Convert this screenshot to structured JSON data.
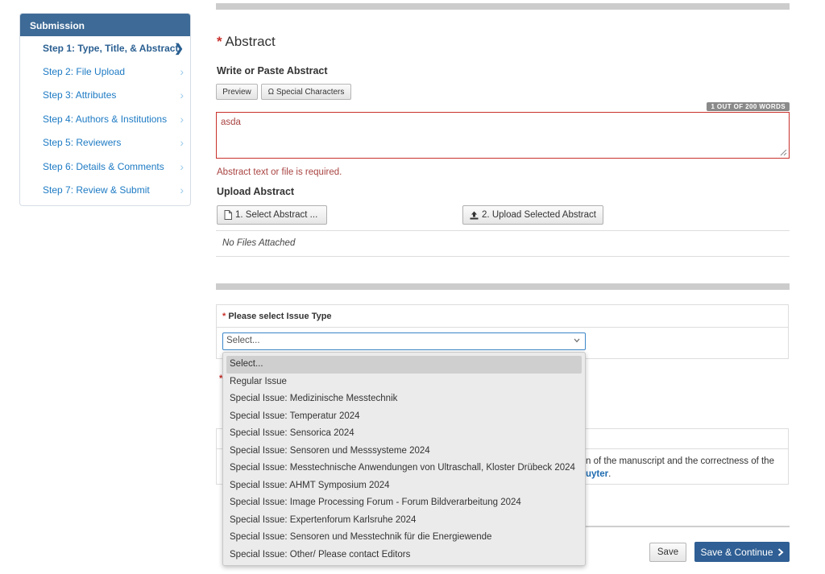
{
  "sidebar": {
    "header": "Submission",
    "steps": [
      {
        "label": "Step 1: Type, Title, & Abstract"
      },
      {
        "label": "Step 2: File Upload"
      },
      {
        "label": "Step 3: Attributes"
      },
      {
        "label": "Step 4: Authors & Institutions"
      },
      {
        "label": "Step 5: Reviewers"
      },
      {
        "label": "Step 6: Details & Comments"
      },
      {
        "label": "Step 7: Review & Submit"
      }
    ],
    "chevron": "›",
    "active_chevron": "❯"
  },
  "abstract": {
    "required_mark": "*",
    "title": "Abstract",
    "write_heading": "Write or Paste Abstract",
    "preview_label": "Preview",
    "special_chars_label": "Ω Special Characters",
    "word_count": "1 OUT OF 200 WORDS",
    "text_value": "asda",
    "error": "Abstract text or file is required.",
    "upload_heading": "Upload Abstract",
    "select_file_label": "1. Select Abstract ...",
    "upload_file_label": "2. Upload Selected Abstract",
    "no_files": "No Files Attached"
  },
  "issue_type": {
    "required_mark": "*",
    "label": "Please select Issue Type",
    "selected_value": "Select...",
    "options": [
      "Select...",
      "Regular Issue",
      "Special Issue: Medizinische Messtechnik",
      "Special Issue: Temperatur 2024",
      "Special Issue: Sensorica 2024",
      "Special Issue: Sensoren und Messsysteme 2024",
      "Special Issue: Messtechnische Anwendungen von Ultraschall, Kloster Drübeck 2024",
      "Special Issue: AHMT Symposium 2024",
      "Special Issue: Image Processing Forum - Forum Bildverarbeitung 2024",
      "Special Issue: Expertenforum Karlsruhe 2024",
      "Special Issue: Sensoren und Messtechnik für die Energiewende",
      "Special Issue: Other/ Please contact Editors"
    ]
  },
  "background": {
    "partial_text": "n of the manuscript and the correctness of the",
    "partial_link": "uyter",
    "partial_link_suffix": "."
  },
  "footer": {
    "save_label": "Save",
    "continue_label": "Save & Continue"
  },
  "colors": {
    "header_bg": "#3d6a96",
    "link": "#1e7bc4",
    "error": "#a94442",
    "primary_button": "#2f5f94"
  },
  "icons": {
    "file": "file-icon",
    "upload": "upload-icon",
    "chevron": "chevron-right-icon",
    "select_arrow": "chevron-down-icon"
  }
}
